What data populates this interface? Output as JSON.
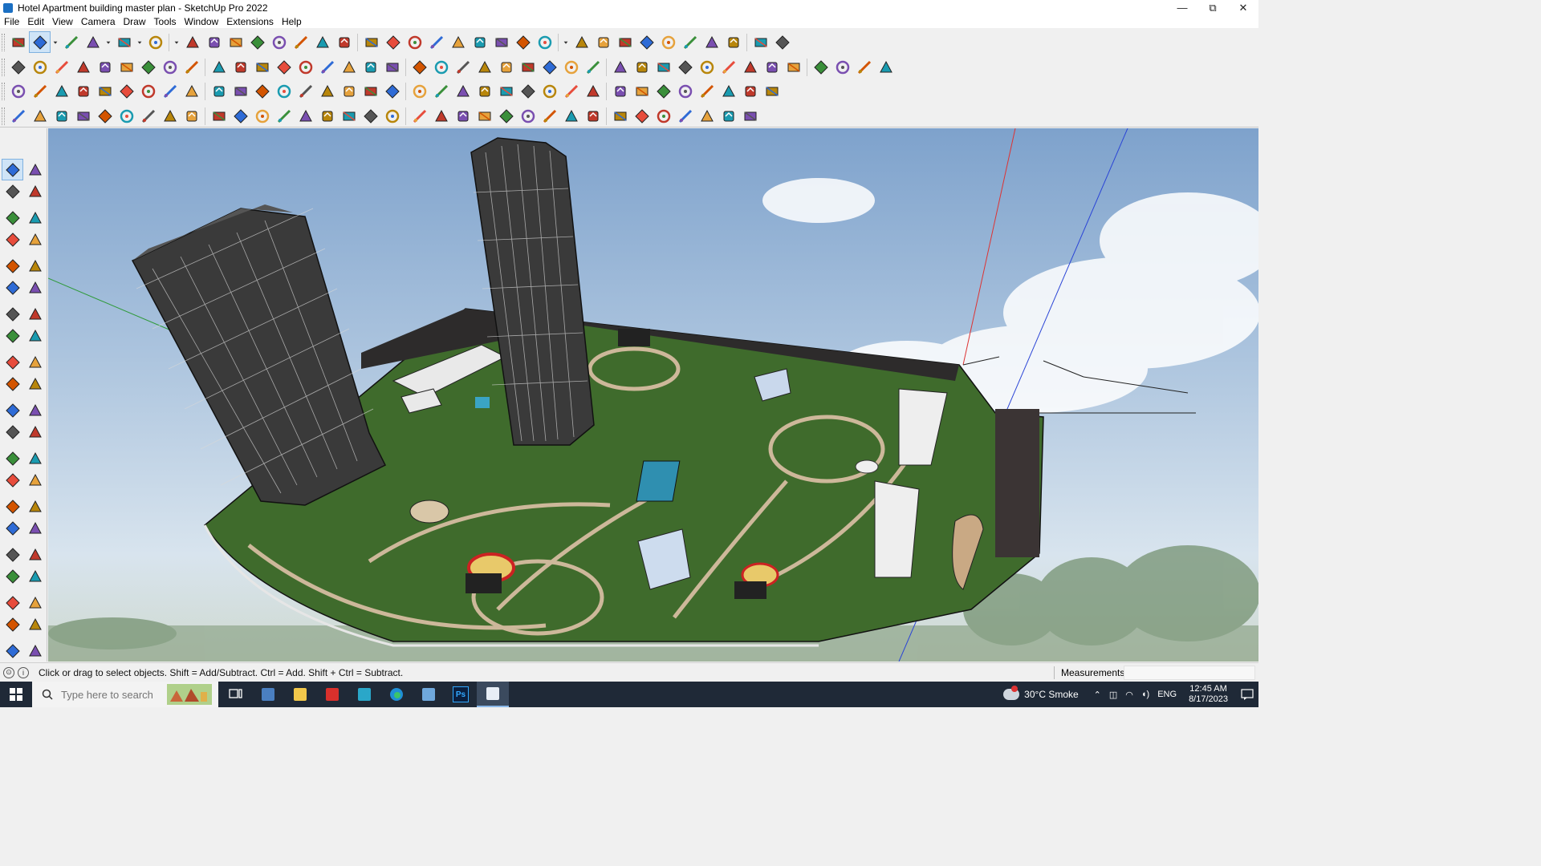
{
  "window": {
    "title": "Hotel Apartment building master plan - SketchUp Pro 2022",
    "controls": [
      "minimize",
      "maximize",
      "close"
    ],
    "control_glyphs": [
      "—",
      "⧉",
      "✕"
    ]
  },
  "menu": [
    "File",
    "Edit",
    "View",
    "Camera",
    "Draw",
    "Tools",
    "Window",
    "Extensions",
    "Help"
  ],
  "toolbar_rows": [
    {
      "row": 1,
      "tools": [
        "zoom-icon",
        "select-icon",
        "dropdown-icon",
        "eraser-icon",
        "line-icon",
        "dropdown-icon",
        "arc-icon",
        "dropdown-icon",
        "rectangle-icon",
        "dropdown-icon",
        "push-pull-icon",
        "follow-me-icon",
        "move-icon",
        "rotate-icon",
        "scale-icon",
        "tape-measure-icon",
        "text-icon",
        "paint-bucket-icon",
        "orbit-icon",
        "pan-icon",
        "zoom-window-icon",
        "zoom-extents-icon",
        "component-icon",
        "group-icon",
        "layers-icon",
        "styles-icon",
        "account-icon",
        "dropdown-icon",
        "warehouse-icon",
        "extension-warehouse-icon",
        "sandbox-icon",
        "sort-down-icon",
        "sort-up-icon",
        "axes-icon",
        "section-icon",
        "undo-icon",
        "redo-icon",
        "ruby-icon"
      ]
    },
    {
      "row": 2,
      "tools": [
        "iso-view-icon",
        "top-view-icon",
        "front-view-icon",
        "push-pull-red-icon",
        "move-blue-icon",
        "array-icon",
        "rotate-copy-icon",
        "scale-copy-icon",
        "mirror-icon",
        "offset-icon",
        "intersect-icon",
        "trim-icon",
        "extend-icon",
        "sandbox-from-contours-icon",
        "sandbox-scratch-icon",
        "house-icon",
        "home-icon",
        "garage-icon",
        "shed-icon",
        "roof-icon",
        "dimension-icon",
        "protractor-icon",
        "pencil-icon",
        "circle-icon",
        "polygon-icon",
        "ellipse-icon",
        "parallelogram-icon",
        "curve-icon",
        "spiral-icon",
        "bezier-icon",
        "fillet-icon",
        "chamfer-icon",
        "eraser-red-icon",
        "material-icon",
        "wall-icon",
        "floor-icon",
        "stairs-icon",
        "railing-icon",
        "door-icon",
        "window-icon"
      ]
    },
    {
      "row": 3,
      "tools": [
        "face-icon",
        "plane-icon",
        "solid-icon",
        "text-label-icon",
        "paint-red-icon",
        "camera-icon",
        "loop-icon",
        "square-red-icon",
        "table-icon",
        "frame-icon",
        "wood-icon",
        "hook-icon",
        "node-icon",
        "cross-red-icon",
        "plus-green-icon",
        "x-blue-icon",
        "cone-icon",
        "droplet-icon",
        "warning-icon",
        "lasso-icon",
        "tie-icon",
        "rope-icon",
        "transform-icon",
        "drag-icon",
        "magnet-icon",
        "chain-icon",
        "box-icon",
        "gear-red-icon",
        "grid-icon",
        "frame-blue-icon",
        "panel-icon",
        "tile-icon",
        "cross-icon",
        "dots-icon",
        "tiles-icon"
      ]
    },
    {
      "row": 4,
      "tools": [
        "polyline-icon",
        "bezier-red-icon",
        "point-red-icon",
        "sphere-icon",
        "cylinder-icon",
        "torus-icon",
        "capsule-icon",
        "bend-icon",
        "corner-icon",
        "stair-corner-icon",
        "knife-icon",
        "slice-icon",
        "cap-icon",
        "extrude-icon",
        "fence-icon",
        "railing-grey-icon",
        "glove-icon",
        "leaf-icon",
        "arrow-left-icon",
        "comb-icon",
        "blade-icon",
        "wave-icon",
        "spring-icon",
        "roof-tool-icon",
        "slab-icon",
        "column-icon",
        "pillar-icon",
        "stairs-grey-icon",
        "grille-icon",
        "mesh-icon",
        "wire-icon",
        "tree-icon",
        "palm-icon",
        "gear-grey-icon"
      ]
    }
  ],
  "left_tools": [
    "select-icon",
    "orbit-icon",
    "paint-bucket-icon",
    "eraser-icon",
    "component-icon",
    "tape-measure-icon",
    "line-icon",
    "freehand-icon",
    "rectangle-icon",
    "rotated-rectangle-icon",
    "circle-icon",
    "polygon-icon",
    "arc-icon",
    "pie-icon",
    "two-point-arc-icon",
    "three-point-arc-icon",
    "move-icon",
    "push-pull-icon",
    "rotate-icon",
    "follow-me-icon",
    "scale-icon",
    "offset-icon",
    "tape-measure-icon",
    "dimension-icon",
    "protractor-icon",
    "text-icon",
    "axes-icon",
    "3d-text-icon",
    "orbit-icon",
    "pan-icon",
    "zoom-icon",
    "zoom-window-icon",
    "zoom-extents-icon",
    "previous-icon",
    "position-camera-icon",
    "look-around-icon",
    "walk-icon",
    "section-plane-icon",
    "sandbox-icon",
    "terrain-icon",
    "layers-icon",
    "styles-icon"
  ],
  "model": {
    "description_visible": false,
    "sky_colors": [
      "#7ea2cc",
      "#d8e4ee"
    ],
    "ground_color": "#3f6b2c",
    "path_color": "#cdb89a",
    "tower_color": "#3a3a3a"
  },
  "status": {
    "hint": "Click or drag to select objects. Shift = Add/Subtract. Ctrl = Add. Shift + Ctrl = Subtract.",
    "measurements_label": "Measurements",
    "measurements_value": ""
  },
  "taskbar": {
    "search_placeholder": "Type here to search",
    "apps": [
      "task-view-icon",
      "calculator-icon",
      "file-explorer-icon",
      "acrobat-icon",
      "media-icon",
      "edge-icon",
      "snipping-icon",
      "photoshop-icon",
      "sketchup-icon"
    ],
    "app_labels": {
      "photoshop": "Ps"
    },
    "weather": "30°C  Smoke",
    "lang": "ENG",
    "time": "12:45 AM",
    "date": "8/17/2023"
  }
}
